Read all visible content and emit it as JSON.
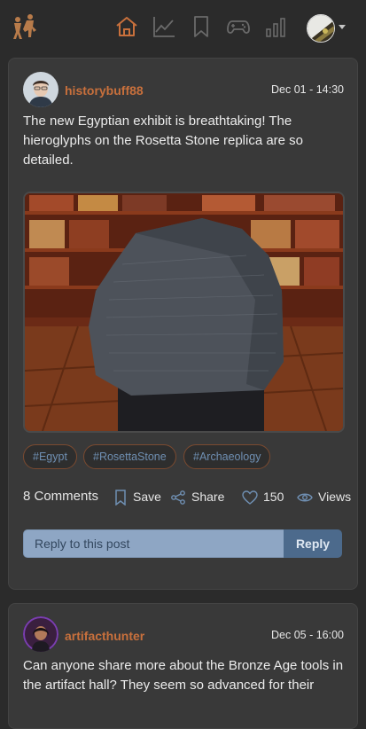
{
  "colors": {
    "accent": "#c8703c",
    "background": "#2b2b2b",
    "card": "#393939",
    "tag_text": "#6f8fb2",
    "reply_button": "#4c6a8c"
  },
  "nav": {
    "icons": [
      "logo-icon",
      "home-icon",
      "chart-icon",
      "bookmark-icon",
      "gamepad-icon",
      "signal-bars-icon",
      "user-avatar"
    ],
    "active": "home-icon"
  },
  "posts": [
    {
      "username": "historybuff88",
      "timestamp": "Dec 01 - 14:30",
      "text": "The new Egyptian exhibit is breathtaking! The hieroglyphs on the Rosetta Stone replica are so detailed.",
      "tags": [
        "#Egypt",
        "#RosettaStone",
        "#Archaeology"
      ],
      "comments": "8 Comments",
      "save": "Save",
      "share": "Share",
      "likes": "150",
      "views": "Views",
      "reply_placeholder": "Reply to this post",
      "reply_button": "Reply"
    },
    {
      "username": "artifacthunter",
      "timestamp": "Dec 05 - 16:00",
      "text": "Can anyone share more about the Bronze Age tools in the artifact hall? They seem so advanced for their"
    }
  ]
}
